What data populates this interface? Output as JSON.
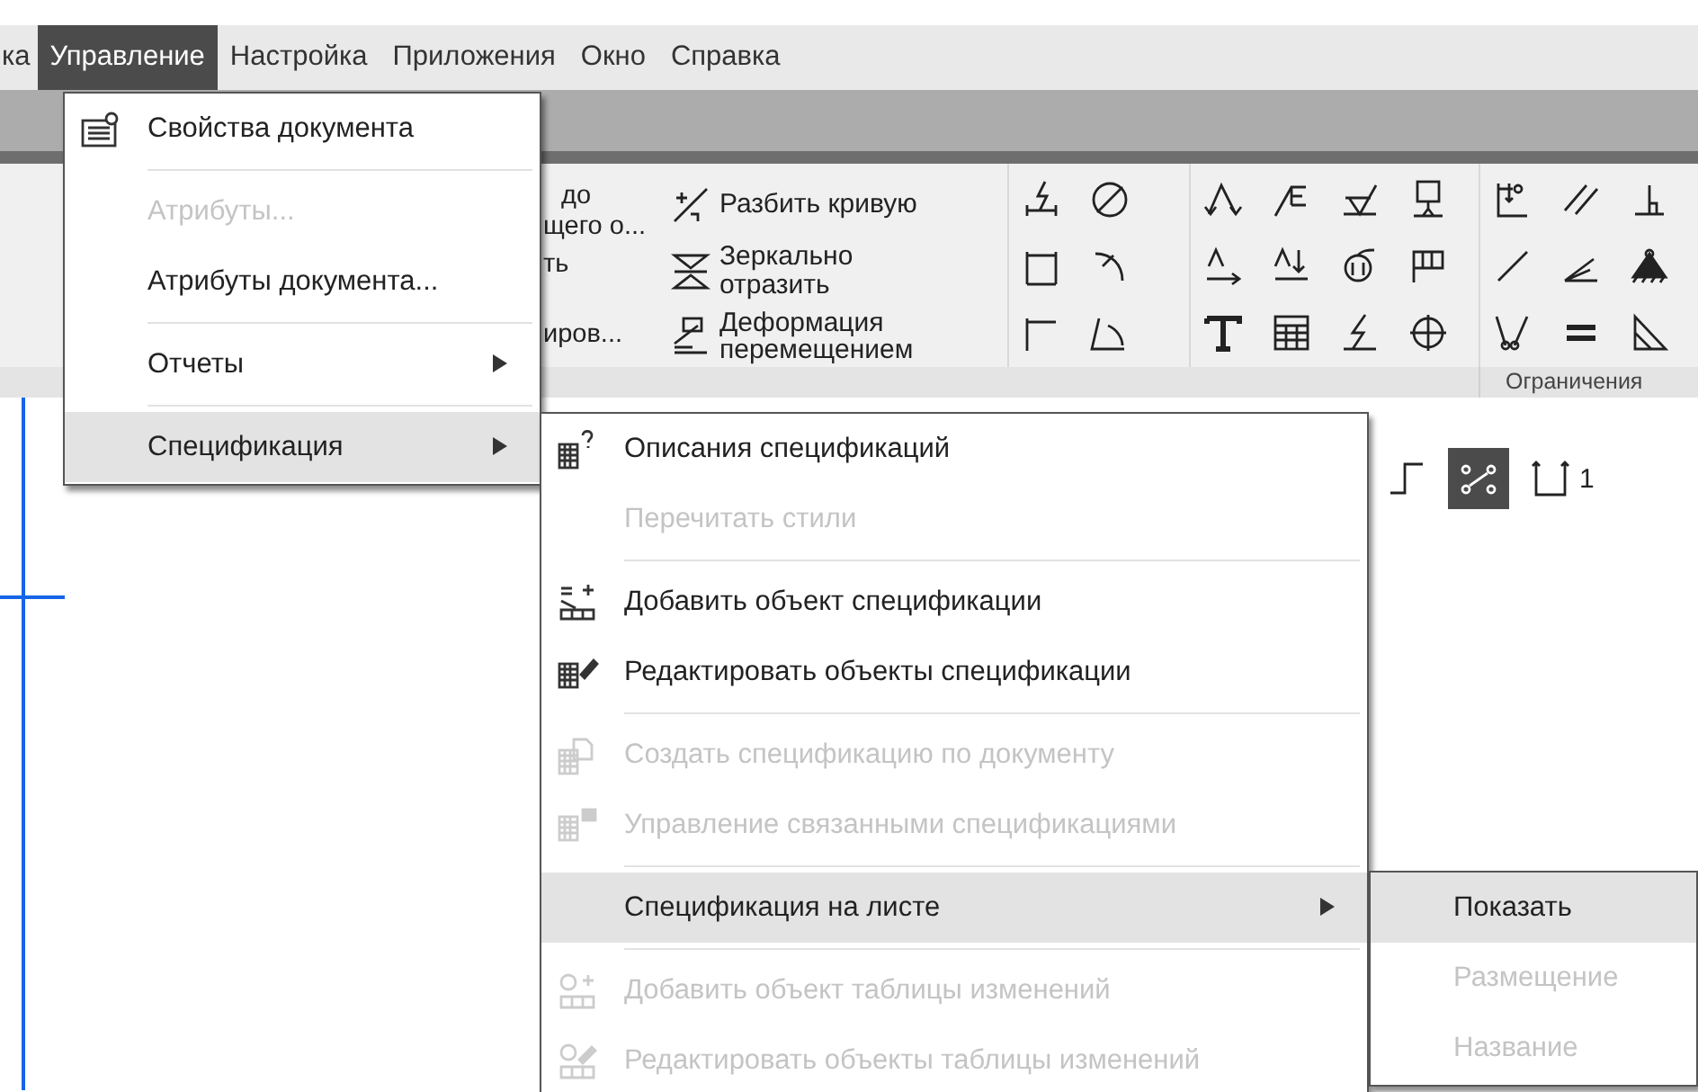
{
  "menubar": [
    {
      "label": "ка",
      "selected": false
    },
    {
      "label": "Управление",
      "selected": true
    },
    {
      "label": "Настройка",
      "selected": false
    },
    {
      "label": "Приложения",
      "selected": false
    },
    {
      "label": "Окно",
      "selected": false
    },
    {
      "label": "Справка",
      "selected": false
    }
  ],
  "ribbon": {
    "fragments": [
      "до",
      "щего о...",
      "ть",
      "иров..."
    ],
    "commands": [
      {
        "label": "Разбить кривую"
      },
      {
        "label": "Зеркально отразить"
      },
      {
        "label": "Деформация перемещением"
      }
    ],
    "groups": [
      {
        "label": "Ограничения"
      }
    ]
  },
  "toolbar": {
    "buttons": [
      {
        "on": false
      },
      {
        "on": true
      },
      {
        "on": false,
        "label": "1"
      }
    ]
  },
  "menus": [
    {
      "items": [
        {
          "label": "Свойства документа",
          "disabled": false,
          "selected": false,
          "submenu": false,
          "separator_after": true
        },
        {
          "label": "Атрибуты...",
          "disabled": true,
          "selected": false,
          "submenu": false,
          "separator_after": false
        },
        {
          "label": "Атрибуты документа...",
          "disabled": false,
          "selected": false,
          "submenu": false,
          "separator_after": true
        },
        {
          "label": "Отчеты",
          "disabled": false,
          "selected": false,
          "submenu": true,
          "separator_after": true
        },
        {
          "label": "Спецификация",
          "disabled": false,
          "selected": true,
          "submenu": true,
          "separator_after": false
        }
      ]
    },
    {
      "items": [
        {
          "label": "Описания спецификаций",
          "disabled": false,
          "selected": false,
          "submenu": false,
          "separator_after": false
        },
        {
          "label": "Перечитать стили",
          "disabled": true,
          "selected": false,
          "submenu": false,
          "separator_after": true
        },
        {
          "label": "Добавить объект спецификации",
          "disabled": false,
          "selected": false,
          "submenu": false,
          "separator_after": false
        },
        {
          "label": "Редактировать объекты спецификации",
          "disabled": false,
          "selected": false,
          "submenu": false,
          "separator_after": true
        },
        {
          "label": "Создать спецификацию по документу",
          "disabled": true,
          "selected": false,
          "submenu": false,
          "separator_after": false
        },
        {
          "label": "Управление связанными спецификациями",
          "disabled": true,
          "selected": false,
          "submenu": false,
          "separator_after": true
        },
        {
          "label": "Спецификация на листе",
          "disabled": false,
          "selected": true,
          "submenu": true,
          "separator_after": true
        },
        {
          "label": "Добавить объект таблицы изменений",
          "disabled": true,
          "selected": false,
          "submenu": false,
          "separator_after": false
        },
        {
          "label": "Редактировать объекты таблицы изменений",
          "disabled": true,
          "selected": false,
          "submenu": false,
          "separator_after": false
        }
      ]
    },
    {
      "items": [
        {
          "label": "Показать",
          "disabled": false,
          "selected": true,
          "submenu": false,
          "separator_after": false
        },
        {
          "label": "Размещение",
          "disabled": true,
          "selected": false,
          "submenu": false,
          "separator_after": false
        },
        {
          "label": "Название",
          "disabled": true,
          "selected": false,
          "submenu": false,
          "separator_after": false
        }
      ]
    }
  ]
}
